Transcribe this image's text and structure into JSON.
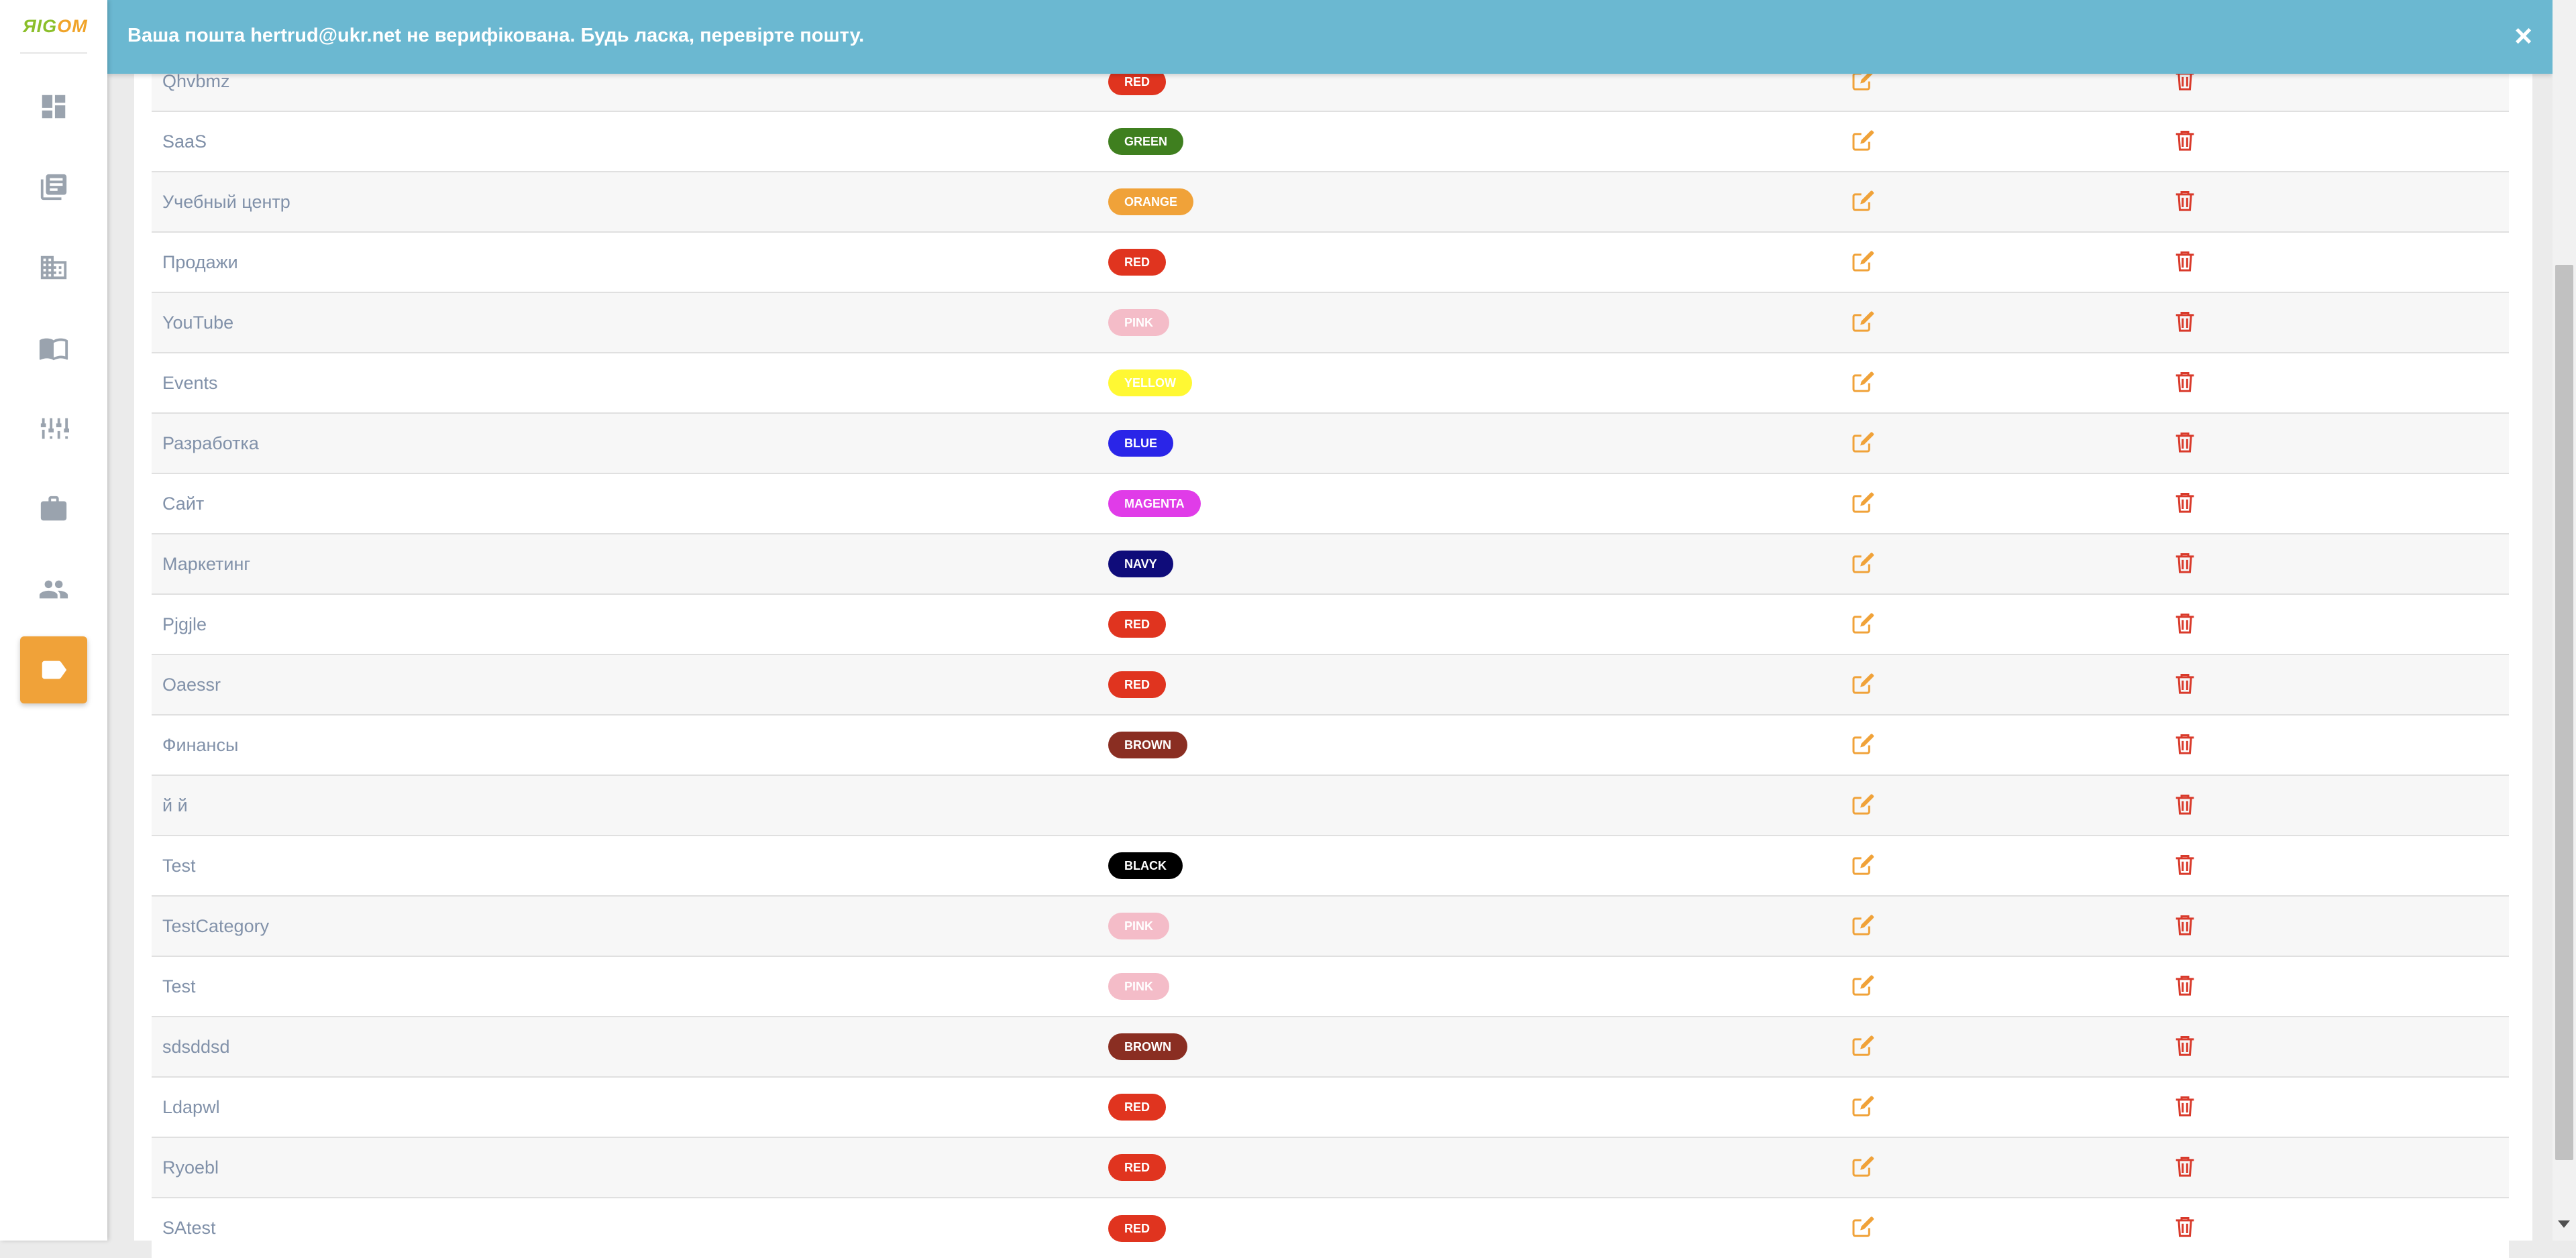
{
  "app": {
    "logo_part1": "ЯIG",
    "logo_part2": "OM"
  },
  "sidebar": {
    "items": [
      {
        "name": "dashboard",
        "icon": "dashboard-icon",
        "active": false
      },
      {
        "name": "articles",
        "icon": "article-icon",
        "active": false
      },
      {
        "name": "companies",
        "icon": "building-icon",
        "active": false
      },
      {
        "name": "knowledge",
        "icon": "book-open-icon",
        "active": false
      },
      {
        "name": "settings",
        "icon": "sliders-icon",
        "active": false
      },
      {
        "name": "jobs",
        "icon": "briefcase-icon",
        "active": false
      },
      {
        "name": "users",
        "icon": "people-icon",
        "active": false
      },
      {
        "name": "tags",
        "icon": "tag-icon",
        "active": true
      }
    ]
  },
  "banner": {
    "message": "Ваша пошта hertrud@ukr.net не верифікована. Будь ласка, перевірте пошту.",
    "close": "×"
  },
  "colors": {
    "accent": "#f0a239",
    "banner": "#6bb8d1",
    "edit_icon": "#f0a239",
    "delete_icon": "#d93a2b",
    "row_text": "#8191a9"
  },
  "categories": [
    {
      "name": "Qhvbmz",
      "badge": "RED",
      "badge_color": "#e0341f"
    },
    {
      "name": "SaaS",
      "badge": "GREEN",
      "badge_color": "#3f7f1f"
    },
    {
      "name": "Учебный центр",
      "badge": "ORANGE",
      "badge_color": "#f0a239"
    },
    {
      "name": "Продажи",
      "badge": "RED",
      "badge_color": "#e0341f"
    },
    {
      "name": "YouTube",
      "badge": "PINK",
      "badge_color": "#f4bcc8"
    },
    {
      "name": "Events",
      "badge": "YELLOW",
      "badge_color": "#fff833"
    },
    {
      "name": "Разработка",
      "badge": "BLUE",
      "badge_color": "#2a25e8"
    },
    {
      "name": "Сайт",
      "badge": "MAGENTA",
      "badge_color": "#e03ce8"
    },
    {
      "name": "Маркетинг",
      "badge": "NAVY",
      "badge_color": "#0f0c7a"
    },
    {
      "name": "Pjgjle",
      "badge": "RED",
      "badge_color": "#e0341f"
    },
    {
      "name": "Oaessr",
      "badge": "RED",
      "badge_color": "#e0341f"
    },
    {
      "name": "Финансы",
      "badge": "BROWN",
      "badge_color": "#8a2e22"
    },
    {
      "name": "й й",
      "badge": "",
      "badge_color": ""
    },
    {
      "name": "Test",
      "badge": "BLACK",
      "badge_color": "#000000"
    },
    {
      "name": "TestCategory",
      "badge": "PINK",
      "badge_color": "#f4bcc8"
    },
    {
      "name": "Test",
      "badge": "PINK",
      "badge_color": "#f4bcc8"
    },
    {
      "name": "sdsddsd",
      "badge": "BROWN",
      "badge_color": "#8a2e22"
    },
    {
      "name": "Ldapwl",
      "badge": "RED",
      "badge_color": "#e0341f"
    },
    {
      "name": "Ryoebl",
      "badge": "RED",
      "badge_color": "#e0341f"
    },
    {
      "name": "SAtest",
      "badge": "RED",
      "badge_color": "#e0341f"
    }
  ]
}
